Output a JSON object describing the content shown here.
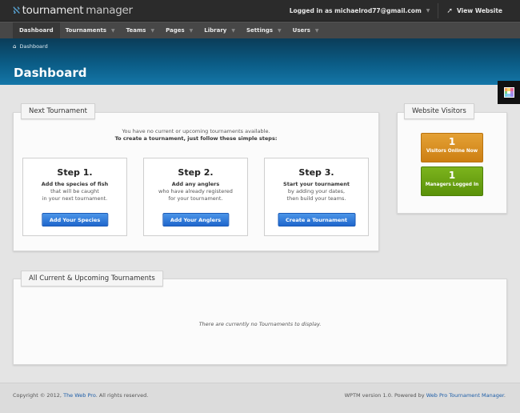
{
  "app": {
    "logo_bold": "tournament",
    "logo_light": "manager",
    "logo_icon": "fish-hook-icon"
  },
  "user_bar": {
    "logged_in_text": "Logged in as michaelrod77@gmail.com",
    "view_website_label": "View Website"
  },
  "nav": {
    "items": [
      {
        "label": "Dashboard",
        "active": true,
        "dropdown": false
      },
      {
        "label": "Tournaments",
        "active": false,
        "dropdown": true
      },
      {
        "label": "Teams",
        "active": false,
        "dropdown": true
      },
      {
        "label": "Pages",
        "active": false,
        "dropdown": true
      },
      {
        "label": "Library",
        "active": false,
        "dropdown": true
      },
      {
        "label": "Settings",
        "active": false,
        "dropdown": true
      },
      {
        "label": "Users",
        "active": false,
        "dropdown": true
      }
    ]
  },
  "breadcrumb": {
    "home_icon": "home-icon",
    "label": "Dashboard"
  },
  "page_title": "Dashboard",
  "next_tournament": {
    "title": "Next Tournament",
    "intro_line1": "You have no current or upcoming tournaments available.",
    "intro_line2": "To create a tournament, just follow these simple steps:",
    "steps": [
      {
        "title": "Step 1.",
        "line1": "Add the species of fish",
        "line2": "that will be caught",
        "line3": "in your next tournament.",
        "button": "Add Your Species"
      },
      {
        "title": "Step 2.",
        "line1": "Add any anglers",
        "line2": "who have already registered",
        "line3": "for your tournament.",
        "button": "Add Your Anglers"
      },
      {
        "title": "Step 3.",
        "line1": "Start your tournament",
        "line2": "by adding your dates,",
        "line3": "then build your teams.",
        "button": "Create a Tournament"
      }
    ]
  },
  "visitors": {
    "title": "Website Visitors",
    "online": {
      "value": "1",
      "label": "Visitors Online Now",
      "color": "#d98c1f"
    },
    "managers": {
      "value": "1",
      "label": "Managers Logged In",
      "color": "#6aa212"
    }
  },
  "all_tournaments": {
    "title": "All Current & Upcoming Tournaments",
    "empty": "There are currently no Tournaments to display."
  },
  "footer": {
    "copyright_prefix": "Copyright © 2012,",
    "company_link": "The Web Pro",
    "copyright_suffix": ". All rights reserved.",
    "version_prefix": "WPTM version 1.0. Powered by",
    "product_link": "Web Pro Tournament Manager",
    "version_suffix": "."
  },
  "colors": {
    "topbar": "#2b2b2b",
    "nav": "#474747",
    "header_blue": "#0b5c86",
    "button_blue": "#2a74d6",
    "link_blue": "#1e5ea8"
  }
}
